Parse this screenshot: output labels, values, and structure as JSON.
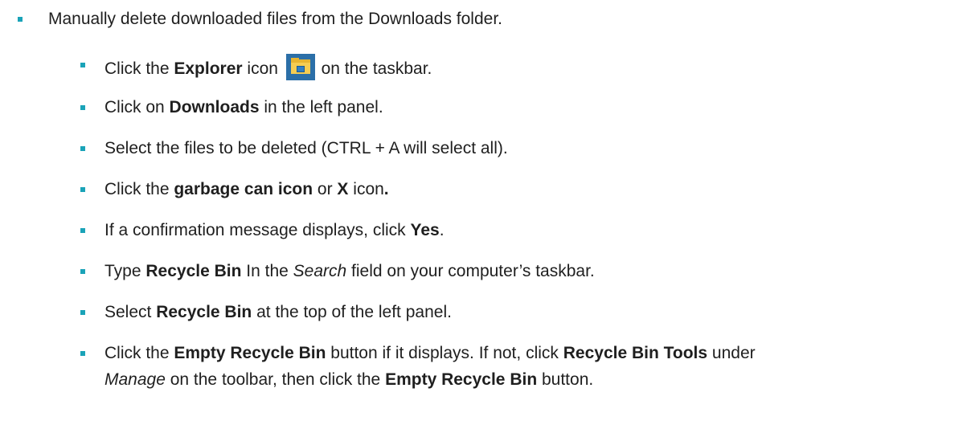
{
  "top": {
    "text": "Manually delete downloaded files from the Downloads folder."
  },
  "steps": {
    "explorer": {
      "pre": "Click the ",
      "bold": "Explorer",
      "mid": " icon",
      "post": " on the taskbar."
    },
    "downloads": {
      "pre": "Click on ",
      "bold": "Downloads",
      "post": " in the left panel."
    },
    "select": {
      "text": "Select the files to be deleted (CTRL + A will select all)."
    },
    "garbage": {
      "pre": "Click the ",
      "bold1": "garbage can icon",
      "mid": " or ",
      "bold2": "X",
      "post": " icon",
      "bold3": "."
    },
    "confirm": {
      "pre": "If a confirmation message displays, click ",
      "bold": "Yes",
      "post": "."
    },
    "type": {
      "pre": "Type ",
      "bold": "Recycle Bin",
      "mid": " In the ",
      "italic": "Search",
      "post": " field on your computer’s taskbar."
    },
    "selectbin": {
      "pre": "Select ",
      "bold": "Recycle Bin",
      "post": " at the top of the left panel."
    },
    "empty": {
      "pre": "Click the ",
      "bold1": "Empty Recycle Bin",
      "mid1": " button if it displays. If not, click ",
      "bold2": "Recycle Bin Tools",
      "mid2": " under",
      "italic": "Manage",
      "mid3": " on the toolbar, then click the ",
      "bold3": "Empty Recycle Bin",
      "post": " button."
    }
  },
  "colors": {
    "bullet": "#1aa3b8",
    "text": "#1f1f1f"
  },
  "icons": {
    "explorer": "file-explorer-icon"
  }
}
